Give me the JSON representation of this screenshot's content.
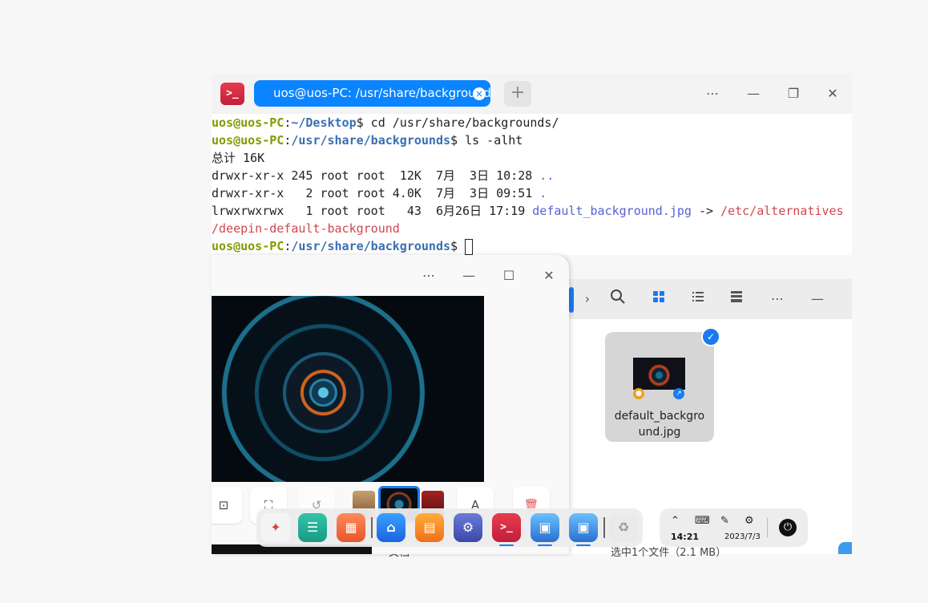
{
  "terminal": {
    "tab_title": "uos@uos-PC: /usr/share/backgrounds",
    "tab_close": "×",
    "add_tab": "+",
    "app_icon": ">_",
    "menu_icon": "⋯",
    "minimize_icon": "—",
    "restore_icon": "❐",
    "close_icon": "✕",
    "lines": [
      {
        "user": "uos@uos-PC",
        "path": "~/Desktop",
        "cmd": "$ cd /usr/share/backgrounds/"
      },
      {
        "user": "uos@uos-PC",
        "path": "/usr/share/backgrounds",
        "cmd": "$ ls -alht"
      }
    ],
    "total": "总计 16K",
    "rows": [
      {
        "text": "drwxr-xr-x 245 root root  12K  7月  3日 10:28 ",
        "name": ".."
      },
      {
        "text": "drwxr-xr-x   2 root root 4.0K  7月  3日 09:51 ",
        "name": "."
      },
      {
        "text": "lrwxrwxrwx   1 root root   43  6月26日 17:19 ",
        "name": "default_background.jpg",
        "arrow": " -> ",
        "target": "/etc/alternatives"
      }
    ],
    "target_cont": "/deepin-default-background",
    "prompt_user": "uos@uos-PC",
    "prompt_path": "/usr/share/backgrounds",
    "prompt_sign": "$ "
  },
  "image_viewer": {
    "menu_icon": "⋯",
    "minimize_icon": "—",
    "maximize_icon": "☐",
    "close_icon": "✕"
  },
  "file_manager": {
    "file_name": "default_background.jpg",
    "status": "选中1个文件（2.1 MB）",
    "sidebar_label": "文档"
  },
  "taskbar": {
    "time": "14:21",
    "date": "2023/7/3",
    "tray_up_icon": "⌃",
    "keyboard_icon": "⌨",
    "pen_icon": "✎",
    "settings_icon": "⚙",
    "power_icon": "⏻"
  }
}
